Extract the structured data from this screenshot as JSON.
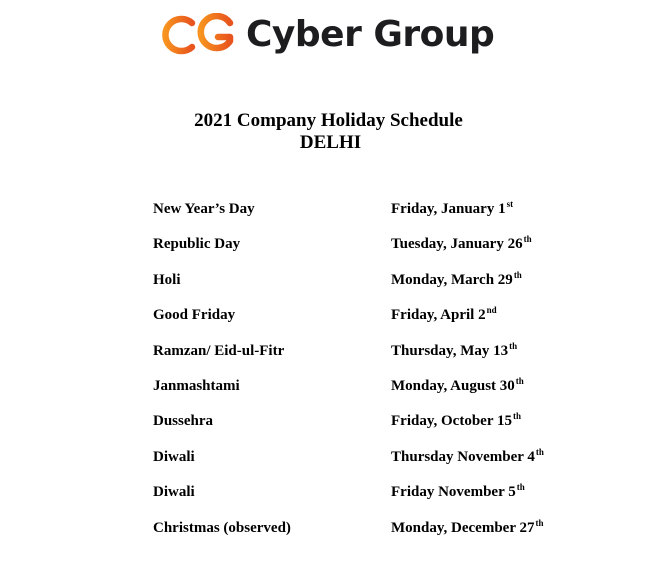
{
  "brand": {
    "name": "Cyber Group",
    "logo_gradient_start": "#f7931e",
    "logo_gradient_end": "#e8541e",
    "text_color": "#1d1d1f"
  },
  "document": {
    "title": "2021 Company Holiday Schedule",
    "location": "DELHI"
  },
  "holidays": [
    {
      "name": "New Year’s Day",
      "date": "Friday, January 1",
      "suffix": "st"
    },
    {
      "name": "Republic Day",
      "date": "Tuesday, January 26",
      "suffix": "th"
    },
    {
      "name": "Holi",
      "date": "Monday, March 29",
      "suffix": "th"
    },
    {
      "name": "Good Friday",
      "date": "Friday, April 2",
      "suffix": "nd"
    },
    {
      "name": "Ramzan/ Eid-ul-Fitr",
      "date": "Thursday, May 13",
      "suffix": "th"
    },
    {
      "name": "Janmashtami",
      "date": "Monday, August 30",
      "suffix": "th"
    },
    {
      "name": "Dussehra",
      "date": "Friday, October 15",
      "suffix": "th"
    },
    {
      "name": "Diwali",
      "date": "Thursday November 4",
      "suffix": "th"
    },
    {
      "name": "Diwali",
      "date": "Friday November 5",
      "suffix": "th"
    },
    {
      "name": "Christmas (observed)",
      "date": "Monday, December 27",
      "suffix": "th"
    }
  ]
}
